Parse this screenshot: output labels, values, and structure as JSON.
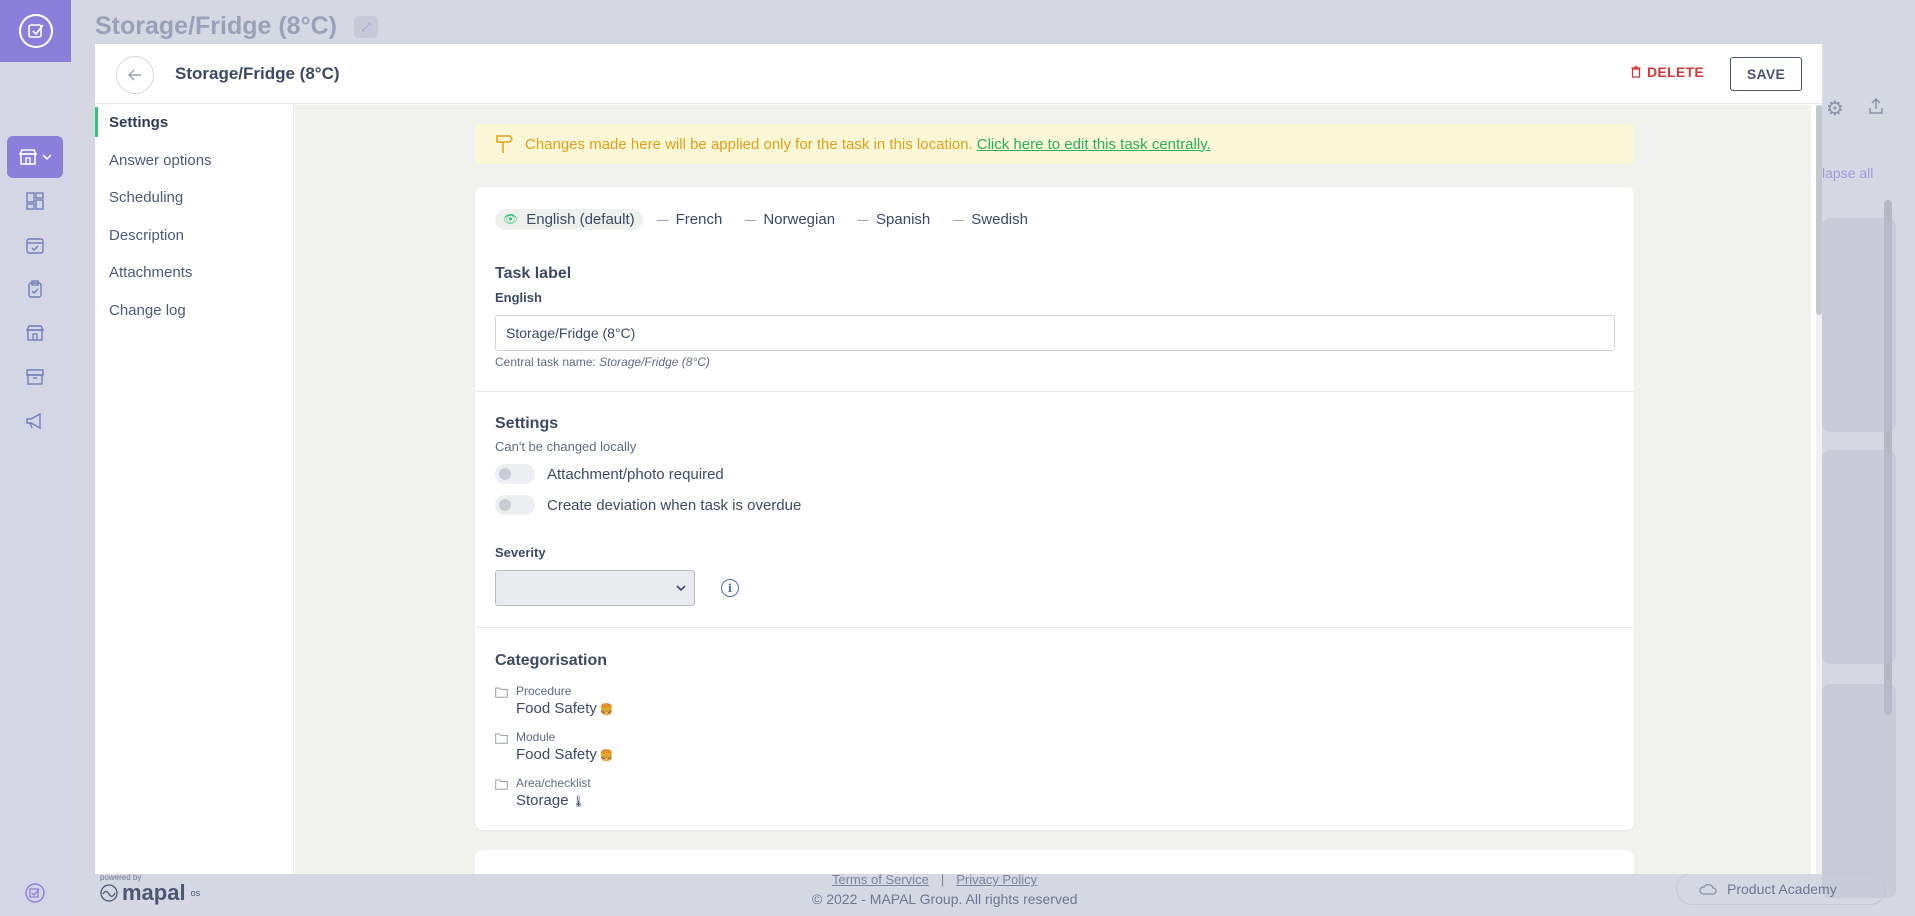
{
  "background": {
    "title": "Storage/Fridge (8°C)",
    "collapse_all_label": "lapse all"
  },
  "modal": {
    "title": "Storage/Fridge (8°C)",
    "delete_label": "DELETE",
    "save_label": "SAVE",
    "nav": [
      {
        "label": "Settings",
        "active": true
      },
      {
        "label": "Answer options",
        "active": false
      },
      {
        "label": "Scheduling",
        "active": false
      },
      {
        "label": "Description",
        "active": false
      },
      {
        "label": "Attachments",
        "active": false
      },
      {
        "label": "Change log",
        "active": false
      }
    ],
    "banner": {
      "text": "Changes made here will be applied only for the task in this location.",
      "link": "Click here to edit this task centrally."
    },
    "languages": [
      {
        "label": "English (default)",
        "active": true
      },
      {
        "label": "French",
        "active": false
      },
      {
        "label": "Norwegian",
        "active": false
      },
      {
        "label": "Spanish",
        "active": false
      },
      {
        "label": "Swedish",
        "active": false
      }
    ],
    "task_label": {
      "heading": "Task label",
      "lang_label": "English",
      "value": "Storage/Fridge (8°C)",
      "hint_prefix": "Central task name:",
      "hint_value": "Storage/Fridge (8°C)"
    },
    "settings": {
      "heading": "Settings",
      "note": "Can't be changed locally",
      "toggles": [
        {
          "label": "Attachment/photo required",
          "on": false
        },
        {
          "label": "Create deviation when task is overdue",
          "on": false
        }
      ],
      "severity_label": "Severity",
      "severity_value": ""
    },
    "categorisation": {
      "heading": "Categorisation",
      "items": [
        {
          "name": "Procedure",
          "value": "Food Safety",
          "emoji": "🍔"
        },
        {
          "name": "Module",
          "value": "Food Safety",
          "emoji": "🍔"
        },
        {
          "name": "Area/checklist",
          "value": "Storage",
          "emoji": "🌡"
        }
      ]
    }
  },
  "footer": {
    "powered_by": "powered by",
    "brand": "mapal",
    "brand_suffix": "os",
    "terms": "Terms of Service",
    "separator": "|",
    "privacy": "Privacy Policy",
    "copyright": "© 2022 - MAPAL Group. All rights reserved",
    "academy": "Product Academy"
  },
  "colors": {
    "accent": "#8b7fdc",
    "active_green": "#35c27a",
    "delete_red": "#d23a3a",
    "banner_text": "#e0a01b"
  }
}
